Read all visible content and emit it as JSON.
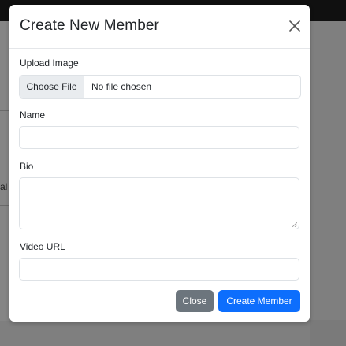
{
  "background": {
    "partial_text": "al"
  },
  "modal": {
    "title": "Create New Member",
    "close_icon": "close-icon",
    "fields": {
      "image": {
        "label": "Upload Image",
        "button_label": "Choose File",
        "status": "No file chosen"
      },
      "name": {
        "label": "Name",
        "value": ""
      },
      "bio": {
        "label": "Bio",
        "value": ""
      },
      "video_url": {
        "label": "Video URL",
        "value": ""
      }
    },
    "footer": {
      "close_label": "Close",
      "create_label": "Create Member"
    }
  },
  "colors": {
    "primary": "#0d6efd",
    "secondary": "#6c757d",
    "backdrop": "#7f7f7f"
  }
}
